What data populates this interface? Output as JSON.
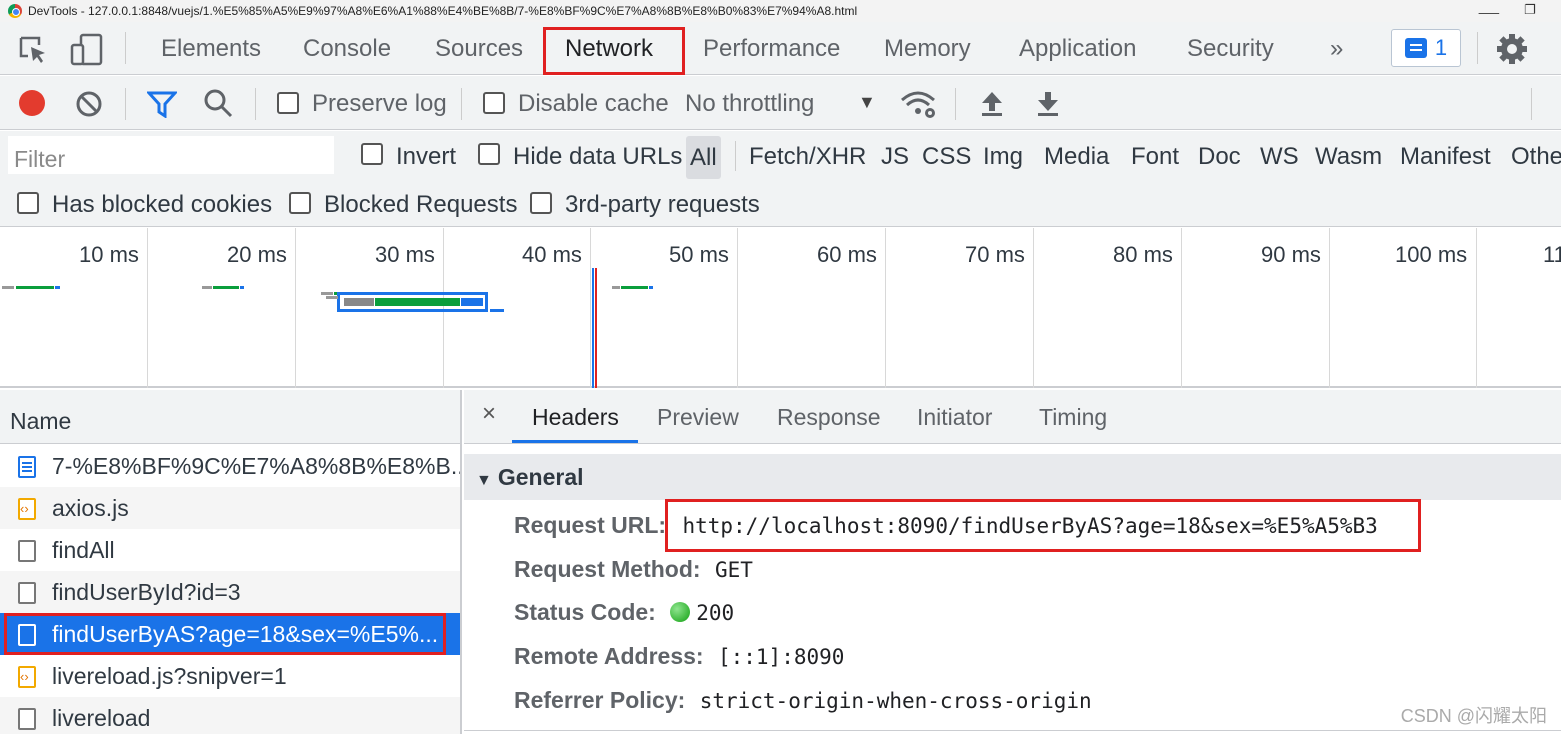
{
  "window": {
    "title": "DevTools - 127.0.0.1:8848/vuejs/1.%E5%85%A5%E9%97%A8%E6%A1%88%E4%BE%8B/7-%E8%BF%9C%E7%A8%8B%E8%B0%83%E7%94%A8.html",
    "minimize": "⸺",
    "restore": "❐"
  },
  "tabs": {
    "elements": "Elements",
    "console": "Console",
    "sources": "Sources",
    "network": "Network",
    "performance": "Performance",
    "memory": "Memory",
    "application": "Application",
    "security": "Security",
    "more": "»",
    "issues_count": "1"
  },
  "toolbar": {
    "preserve_log": "Preserve log",
    "disable_cache": "Disable cache",
    "throttling": "No throttling",
    "dropdown": "▼"
  },
  "filter": {
    "placeholder": "Filter",
    "invert": "Invert",
    "hide_data_urls": "Hide data URLs",
    "types": [
      "All",
      "Fetch/XHR",
      "JS",
      "CSS",
      "Img",
      "Media",
      "Font",
      "Doc",
      "WS",
      "Wasm",
      "Manifest",
      "Othe"
    ],
    "has_blocked_cookies": "Has blocked cookies",
    "blocked_requests": "Blocked Requests",
    "third_party": "3rd-party requests"
  },
  "timeline": {
    "ticks": [
      "10 ms",
      "20 ms",
      "30 ms",
      "40 ms",
      "50 ms",
      "60 ms",
      "70 ms",
      "80 ms",
      "90 ms",
      "100 ms",
      "11"
    ]
  },
  "requests": {
    "header": "Name",
    "items": [
      {
        "name": "7-%E8%BF%9C%E7%A8%8B%E8%B0%83%E7%94%A8.html",
        "display": "7-%E8%BF%9C%E7%A8%8B%E8%B...",
        "type": "doc"
      },
      {
        "name": "axios.js",
        "display": "axios.js",
        "type": "js"
      },
      {
        "name": "findAll",
        "display": "findAll",
        "type": "xhr"
      },
      {
        "name": "findUserById?id=3",
        "display": "findUserById?id=3",
        "type": "xhr"
      },
      {
        "name": "findUserByAS?age=18&sex=%E5%A5%B3",
        "display": "findUserByAS?age=18&sex=%E5%...",
        "type": "xhr",
        "selected": true
      },
      {
        "name": "livereload.js?snipver=1",
        "display": "livereload.js?snipver=1",
        "type": "js"
      },
      {
        "name": "livereload",
        "display": "livereload",
        "type": "xhr"
      }
    ]
  },
  "details": {
    "close": "×",
    "tabs": [
      "Headers",
      "Preview",
      "Response",
      "Initiator",
      "Timing"
    ],
    "general_section": "General",
    "request_url_label": "Request URL:",
    "request_url": "http://localhost:8090/findUserByAS?age=18&sex=%E5%A5%B3",
    "request_method_label": "Request Method:",
    "request_method": "GET",
    "status_code_label": "Status Code:",
    "status_code": "200",
    "remote_address_label": "Remote Address:",
    "remote_address": "[::1]:8090",
    "referrer_policy_label": "Referrer Policy:",
    "referrer_policy": "strict-origin-when-cross-origin"
  },
  "watermark": "CSDN @闪耀太阳"
}
